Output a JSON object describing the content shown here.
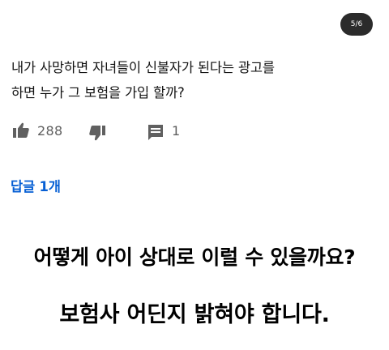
{
  "page_indicator": "5/6",
  "comment": {
    "lines": [
      "내가 사망하면 자녀들이 신불자가 된다는  광고를",
      "하면 누가 그 보험을 가입 할까?"
    ],
    "like_count": "288",
    "reply_count": "1",
    "icons": {
      "like": "thumbs-up-icon",
      "dislike": "thumbs-down-icon",
      "reply": "comment-icon"
    },
    "replies_link": "답글 1개"
  },
  "captions": {
    "line1": "어떻게 아이 상대로 이럴 수 있을까요?",
    "line2": "보험사 어딘지 밝혀야 합니다."
  },
  "colors": {
    "link": "#065fd4",
    "icon": "#606060",
    "badge": "#2b2b2b"
  }
}
